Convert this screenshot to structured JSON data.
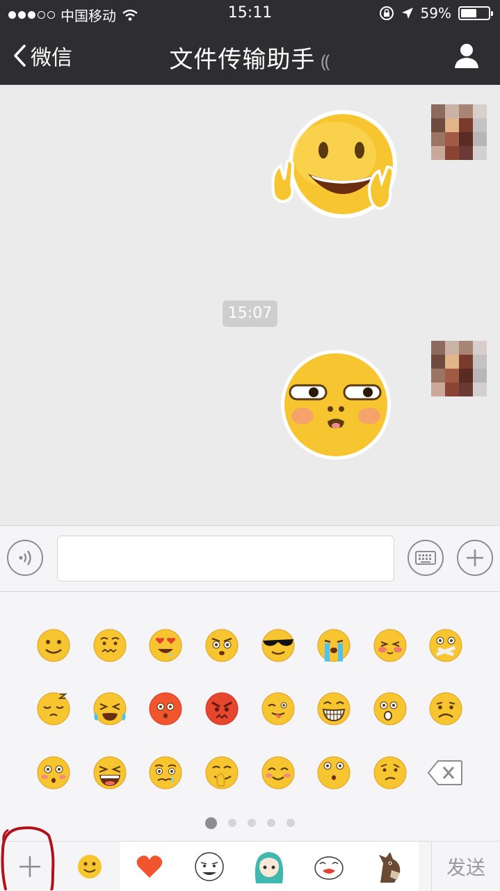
{
  "status_bar": {
    "carrier": "中国移动",
    "time": "15:11",
    "battery_percent": "59%",
    "battery_level": 0.59
  },
  "nav": {
    "back_label": "微信",
    "title": "文件传输助手"
  },
  "chat": {
    "timestamp": "15:07"
  },
  "send_label": "发送",
  "colors": {
    "topbar": "#2e2e32",
    "chat_bg": "#ebebeb",
    "panel_bg": "#f5f5f7",
    "emoji_yellow": "#f7c530",
    "annotation_red": "#b3101b"
  },
  "icons": {
    "signal": "signal-dots-icon",
    "wifi": "wifi-icon",
    "rotation_lock": "rotation-lock-icon",
    "location": "location-arrow-icon",
    "back": "chevron-left-icon",
    "earpiece": "earpiece-icon",
    "profile": "person-icon",
    "voice": "voice-icon",
    "keyboard": "keyboard-icon",
    "add": "plus-icon",
    "delete": "backspace-icon"
  },
  "emoji_pager": {
    "pages": 5,
    "current": 1
  }
}
